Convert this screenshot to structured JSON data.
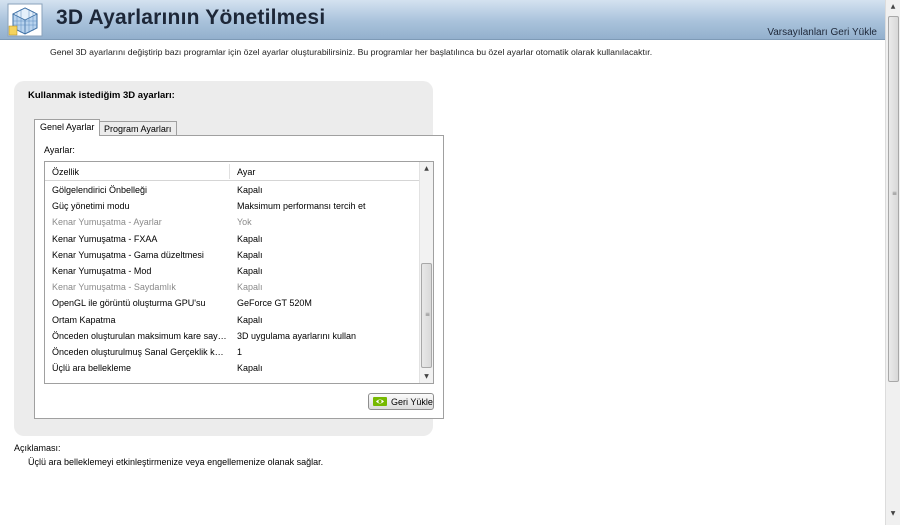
{
  "header": {
    "title": "3D Ayarlarının Yönetilmesi",
    "restore_defaults": "Varsayılanları Geri Yükle"
  },
  "intro": "Genel 3D ayarlarını değiştirip bazı programlar için özel ayarlar oluşturabilirsiniz. Bu programlar her başlatılınca bu özel ayarlar otomatik olarak kullanılacaktır.",
  "panel": {
    "heading": "Kullanmak istediğim 3D ayarları:",
    "tabs": [
      {
        "label": "Genel Ayarlar",
        "selected": true
      },
      {
        "label": "Program Ayarları",
        "selected": false
      }
    ],
    "settings_label": "Ayarlar:",
    "columns": [
      "Özellik",
      "Ayar"
    ],
    "rows": [
      {
        "feature": "Gölgelendirici Önbelleği",
        "value": "Kapalı",
        "disabled": false
      },
      {
        "feature": "Güç yönetimi modu",
        "value": "Maksimum performansı tercih et",
        "disabled": false
      },
      {
        "feature": "Kenar Yumuşatma - Ayarlar",
        "value": "Yok",
        "disabled": true
      },
      {
        "feature": "Kenar Yumuşatma - FXAA",
        "value": "Kapalı",
        "disabled": false
      },
      {
        "feature": "Kenar Yumuşatma - Gama düzeltmesi",
        "value": "Kapalı",
        "disabled": false
      },
      {
        "feature": "Kenar Yumuşatma - Mod",
        "value": "Kapalı",
        "disabled": false
      },
      {
        "feature": "Kenar Yumuşatma - Saydamlık",
        "value": "Kapalı",
        "disabled": true
      },
      {
        "feature": "OpenGL ile görüntü oluşturma GPU'su",
        "value": "GeForce GT 520M",
        "disabled": false
      },
      {
        "feature": "Ortam Kapatma",
        "value": "Kapalı",
        "disabled": false
      },
      {
        "feature": "Önceden oluşturulan maksimum kare sayısı",
        "value": "3D uygulama ayarlarını kullan",
        "disabled": false
      },
      {
        "feature": "Önceden oluşturulmuş Sanal Gerçeklik kar...",
        "value": "1",
        "disabled": false
      },
      {
        "feature": "Üçlü ara bellekleme",
        "value": "Kapalı",
        "disabled": false
      }
    ],
    "restore_button": "Geri Yükle"
  },
  "description": {
    "label": "Açıklaması:",
    "text": "Üçlü ara belleklemeyi etkinleştirmenize veya engellemenize olanak sağlar."
  },
  "icons": {
    "header": "3d-cube-icon",
    "restore": "nvidia-logo-icon"
  },
  "colors": {
    "header_top": "#d4e2f0",
    "header_bottom": "#93b0cd",
    "panel_bg": "#ececec",
    "disabled_text": "#8a8a8a",
    "nvidia_green": "#76b900"
  }
}
